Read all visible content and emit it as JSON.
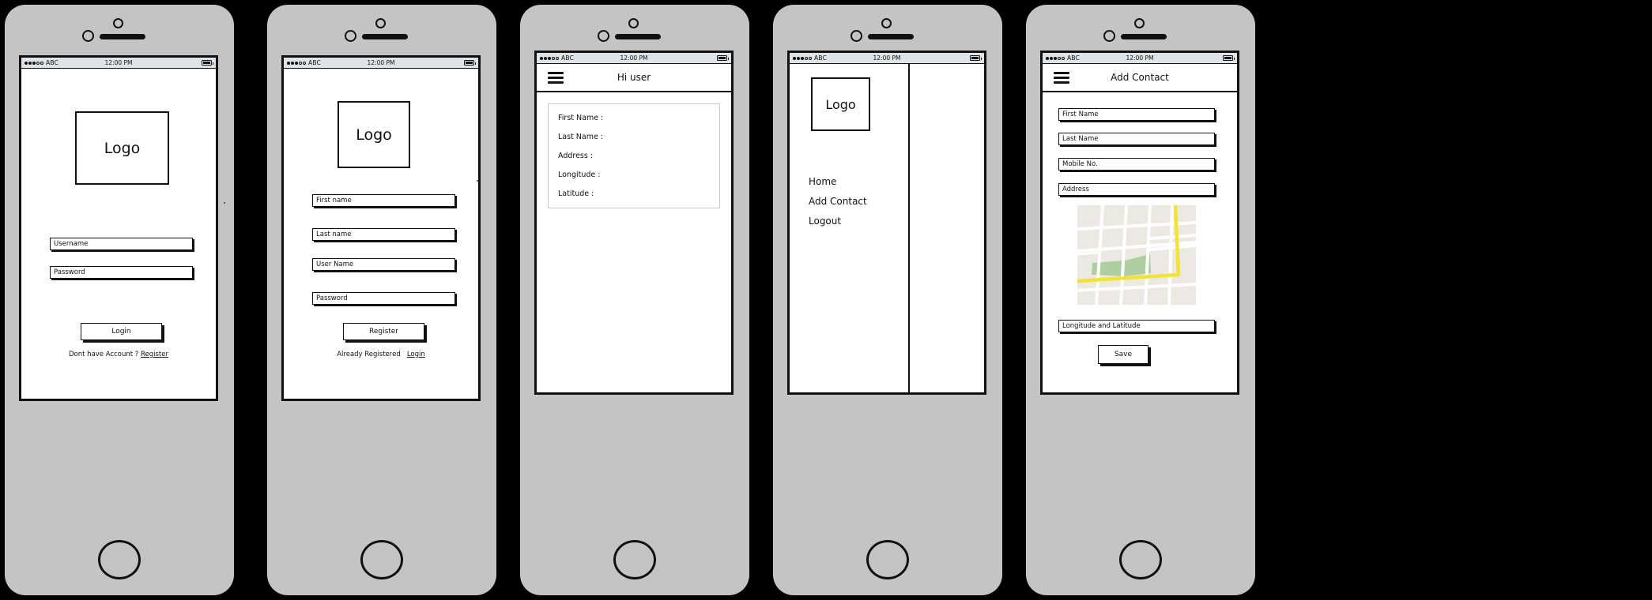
{
  "status_bar": {
    "carrier": "ABC",
    "time": "12:00 PM",
    "signal_filled_dots": 3,
    "signal_empty_dots": 2
  },
  "screens": [
    {
      "id": "login",
      "name": "Login Screen",
      "logo_label": "Logo",
      "fields": [
        {
          "name": "username",
          "placeholder": "Username"
        },
        {
          "name": "password",
          "placeholder": "Password"
        }
      ],
      "primary_button": "Login",
      "footer_text": "Dont have Account ?",
      "footer_link": "Register"
    },
    {
      "id": "register",
      "name": "Register Screen",
      "logo_label": "Logo",
      "fields": [
        {
          "name": "first-name",
          "placeholder": "First name"
        },
        {
          "name": "last-name",
          "placeholder": "Last name"
        },
        {
          "name": "user-name",
          "placeholder": "User Name"
        },
        {
          "name": "password",
          "placeholder": "Password"
        }
      ],
      "primary_button": "Register",
      "footer_text": "Already Registered",
      "footer_link": "Login"
    },
    {
      "id": "home",
      "name": "Home Screen",
      "nav_title": "Hi user",
      "menu_icon": "hamburger-icon",
      "detail_rows": [
        "First Name :",
        "Last Name :",
        "Address :",
        "Longitude :",
        "Latitude :"
      ]
    },
    {
      "id": "drawer",
      "name": "Navigation Drawer",
      "logo_label": "Logo",
      "menu_items": [
        "Home",
        "Add Contact",
        "Logout"
      ]
    },
    {
      "id": "add-contact",
      "name": "Add Contact Screen",
      "nav_title": "Add Contact",
      "menu_icon": "hamburger-icon",
      "fields": [
        {
          "name": "first-name",
          "placeholder": "First Name"
        },
        {
          "name": "last-name",
          "placeholder": "Last Name"
        },
        {
          "name": "mobile-no",
          "placeholder": "Mobile No."
        },
        {
          "name": "address",
          "placeholder": "Address"
        }
      ],
      "map_placeholder": "map-preview",
      "coordinates_field": {
        "name": "longitude-latitude",
        "placeholder": "Longitude and Latitude"
      },
      "primary_button": "Save"
    }
  ],
  "colors": {
    "device_body": "#c4c4c4",
    "outline": "#111111",
    "screen_bg": "#ffffff",
    "statusbar_bg": "#dde3e6",
    "page_bg": "#000000",
    "map_land": "#ece9e3",
    "map_road": "#ffffff",
    "map_highway": "#f2e335",
    "map_park": "#aecfa0"
  }
}
